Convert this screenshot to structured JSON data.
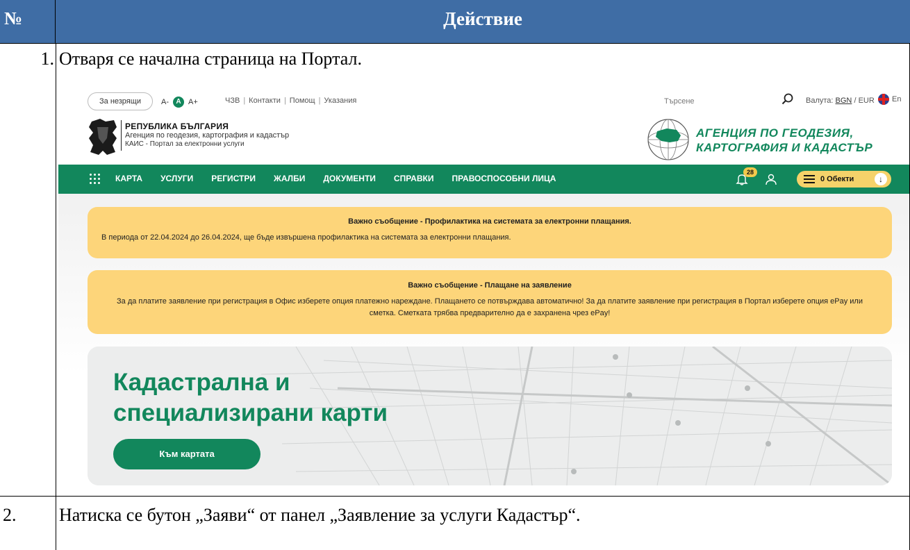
{
  "table": {
    "header": {
      "num": "№",
      "action": "Действие"
    },
    "rows": [
      {
        "num": "1.",
        "text": "Отваря се начална страница на Портал."
      },
      {
        "num": "2.",
        "text": "Натиска се бутон „Заяви“ от панел „Заявление за услуги Кадастър“."
      }
    ]
  },
  "portal": {
    "topbar": {
      "accessibility_button": "За незрящи",
      "font_decrease": "A-",
      "font_normal": "A",
      "font_increase": "A+",
      "links": [
        "ЧЗВ",
        "Контакти",
        "Помощ",
        "Указания"
      ],
      "search_placeholder": "Търсене",
      "currency_label": "Валута:",
      "currency_bgn": "BGN",
      "currency_separator": "/",
      "currency_eur": "EUR",
      "language": "En"
    },
    "branding": {
      "title": "РЕПУБЛИКА БЪЛГАРИЯ",
      "subtitle1": "Агенция по геодезия, картография и кадастър",
      "subtitle2": "КАИС - Портал за електронни услуги",
      "agency_line1": "АГЕНЦИЯ ПО ГЕОДЕЗИЯ,",
      "agency_line2": "КАРТОГРАФИЯ И КАДАСТЪР"
    },
    "nav": {
      "items": [
        "КАРТА",
        "УСЛУГИ",
        "РЕГИСТРИ",
        "ЖАЛБИ",
        "ДОКУМЕНТИ",
        "СПРАВКИ",
        "ПРАВОСПОСОБНИ ЛИЦА"
      ],
      "notifications_count": "28",
      "cart_label": "0 Обекти"
    },
    "notices": [
      {
        "title": "Важно съобщение - Профилактика на системата за електронни плащания.",
        "text": "В периода от 22.04.2024 до 26.04.2024, ще бъде извършена профилактика на системата за електронни плащания."
      },
      {
        "title": "Важно съобщение - Плащане на заявление",
        "text": "За да платите заявление при регистрация в Офис изберете опция  платежно нареждане. Плащането се потвърждава автоматично! За да платите заявление при регистрация в Портал изберете опция ePay или сметка. Сметката трябва предварително да е захранена чрез ePay!"
      }
    ],
    "hero": {
      "title_line1": "Кадастрална и",
      "title_line2": "специализирани карти",
      "button": "Към картата"
    },
    "colors": {
      "green": "#12875c",
      "yellow": "#fdd57a",
      "header_blue": "#3f6da5"
    }
  }
}
